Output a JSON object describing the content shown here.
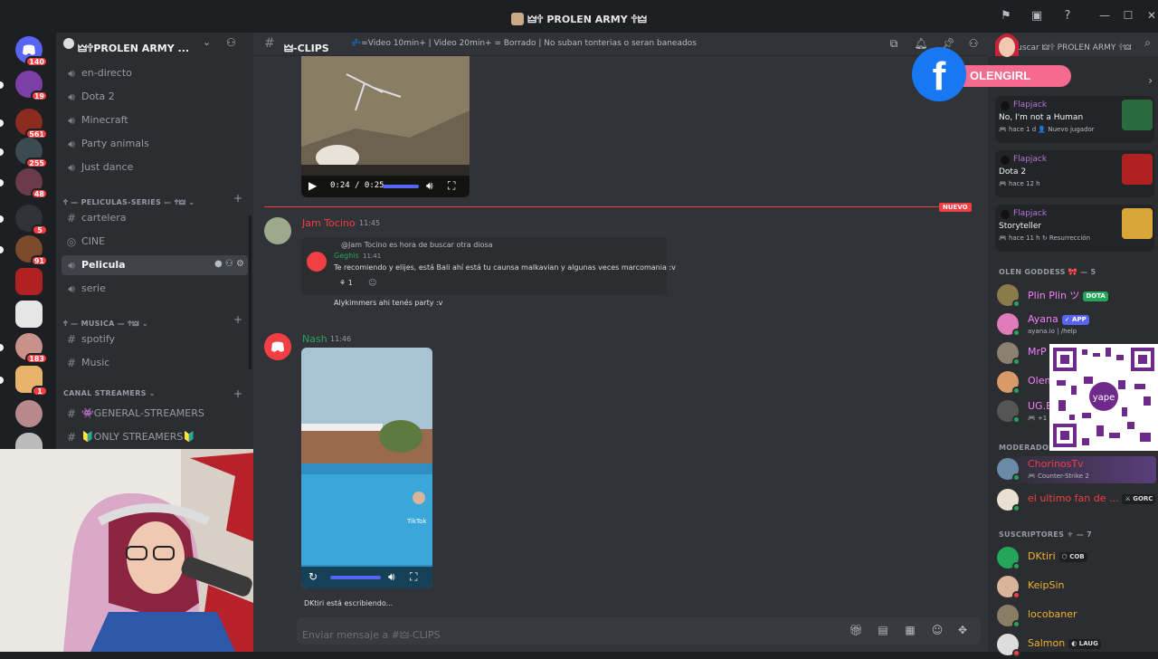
{
  "window": {
    "title": "🜲🕆 PROLEN ARMY 🕆🜲"
  },
  "servers": [
    {
      "badge": "140"
    },
    {
      "badge": "19"
    },
    {
      "badge": "561"
    },
    {
      "badge": "255"
    },
    {
      "badge": "48"
    },
    {
      "badge": "5"
    },
    {
      "badge": "91"
    },
    {
      "badge": ""
    },
    {
      "badge": ""
    },
    {
      "badge": "183"
    },
    {
      "badge": "1"
    },
    {
      "badge": ""
    }
  ],
  "sidebar": {
    "server_name": "🜲🕆PROLEN ARMY ...",
    "channels_top": [
      {
        "label": "en-directo"
      },
      {
        "label": "Dota 2"
      },
      {
        "label": "Minecraft"
      },
      {
        "label": "Party animals"
      },
      {
        "label": "Just dance"
      }
    ],
    "category_peliculas": "🕆 — PELICULAS-SERIES — 🕆🜲 ⌄",
    "channels_peliculas": [
      {
        "label": "cartelera",
        "icon": "#"
      },
      {
        "label": "CINE",
        "icon": "stage"
      },
      {
        "label": "Pelicula",
        "icon": "voice"
      },
      {
        "label": "serie",
        "icon": "voice"
      }
    ],
    "category_musica": "🕆 — MUSICA — 🕆🜲 ⌄",
    "channels_musica": [
      {
        "label": "spotify"
      },
      {
        "label": "Music"
      }
    ],
    "category_streamers": "CANAL STREAMERS ⌄",
    "channels_streamers": [
      {
        "label": "👾GENERAL-STREAMERS"
      },
      {
        "label": "🔰ONLY STREAMERS🔰"
      }
    ]
  },
  "chat": {
    "channel_name": "🜲-CLIPS",
    "topic": "💤=Video 10min+ | Video 20min+ = Borrado | No suban tonterias o seran baneados",
    "video1_time": "0:24 / 0:25",
    "new_label": "NUEVO",
    "messages": [
      {
        "author": "Jam Tocino",
        "author_color": "#f23f43",
        "time": "11:45",
        "reply_to": "@Jam Tocino es hora de buscar otra diosa",
        "embed_author": "Geghis",
        "embed_time": "11:41",
        "embed_text": "Te recomiendo y elijes, está Bali ahí está tu caunsa malkavian y algunas veces marcomania :v",
        "reaction_count": "1",
        "text": "Alykimmers ahi tenés party :v"
      },
      {
        "author": "Nash",
        "author_color": "#23a55a",
        "time": "11:46",
        "video_watermark": "TikTok"
      }
    ],
    "typing": "DKtiri está escribiendo...",
    "composer_placeholder": "Enviar mensaje a #🜲-CLIPS"
  },
  "members": {
    "search_placeholder": "Buscar 🜲🕆 PROLEN ARMY 🕆🜲",
    "activity_cards": [
      {
        "user": "Flapjack",
        "game": "No, I'm not a Human",
        "meta": "🎮 hace 1 d   👤 Nuevo jugador",
        "art": "#2a6b3d"
      },
      {
        "user": "Flapjack",
        "game": "Dota 2",
        "meta": "🎮 hace 12 h",
        "art": "#b0221f"
      },
      {
        "user": "Flapjack",
        "game": "Storyteller",
        "meta": "🎮 hace 11 h   ↻ Resurrección",
        "art": "#d9a63a"
      }
    ],
    "group_goddess": "OLEN GODDESS 🎀 — 5",
    "goddess": [
      {
        "name": "Plin Plin ツ",
        "color": "#f47fff",
        "tag": "DOTA",
        "tag_bg": "#23a55a",
        "sub": ""
      },
      {
        "name": "Ayana",
        "color": "#f47fff",
        "tag": "✓ APP",
        "tag_bg": "#5865f2",
        "sub": "ayana.io | /help"
      },
      {
        "name": "MrP",
        "color": "#f47fff",
        "tag": "",
        "tag_bg": "",
        "sub": ""
      },
      {
        "name": "Olen",
        "color": "#f47fff",
        "tag": "",
        "tag_bg": "",
        "sub": ""
      },
      {
        "name": "UG.E",
        "color": "#f47fff",
        "tag": "",
        "tag_bg": "",
        "sub": "🎮 +1 C"
      }
    ],
    "group_mod": "MODERADOR",
    "mods": [
      {
        "name": "ChorinosTv",
        "color": "#f23f43",
        "tag": "",
        "tag_bg": "",
        "sub": "🎮 Counter-Strike 2"
      },
      {
        "name": "el ultimo fan de ...",
        "color": "#f23f43",
        "tag": "⚔ GORC",
        "tag_bg": "#1e1f22",
        "sub": ""
      }
    ],
    "group_subs": "SUSCRIPTORES ⚜ — 7",
    "subs": [
      {
        "name": "DKtiri",
        "color": "#f0b232",
        "tag": "⬡ COB",
        "tag_bg": "#1e1f22",
        "sub": ""
      },
      {
        "name": "KeipSin",
        "color": "#f0b232",
        "tag": "",
        "tag_bg": "",
        "sub": ""
      },
      {
        "name": "locobaner",
        "color": "#f0b232",
        "tag": "",
        "tag_bg": "",
        "sub": ""
      },
      {
        "name": "Salmon",
        "color": "#f0b232",
        "tag": "◐ LAUG",
        "tag_bg": "#1e1f22",
        "sub": ""
      }
    ]
  },
  "overlay": {
    "fb_name": "OLENGIRL",
    "qr_brand": "yape"
  },
  "colors": {
    "accent": "#5865f2",
    "danger": "#f23f43",
    "online": "#23a55a"
  }
}
